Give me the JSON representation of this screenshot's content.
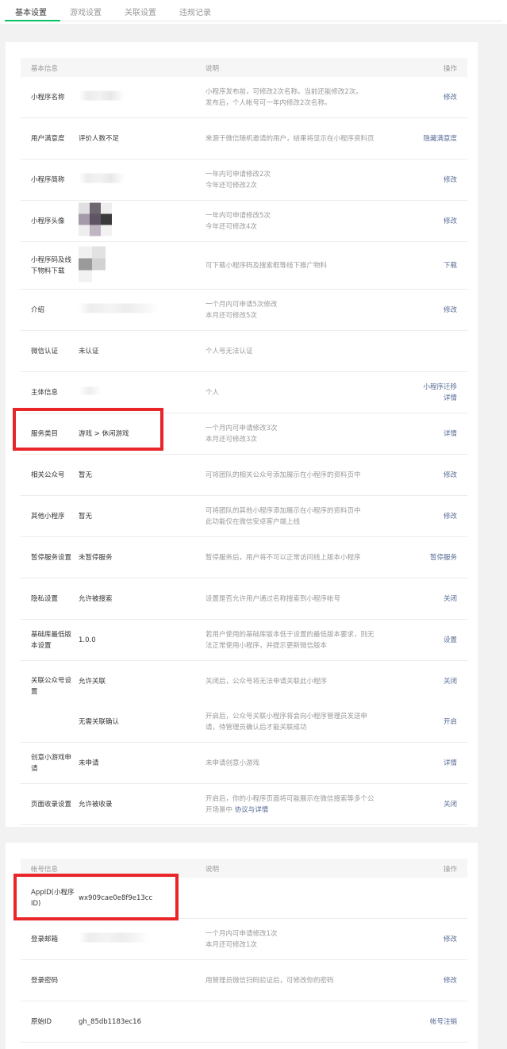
{
  "tabs": [
    "基本设置",
    "游戏设置",
    "关联设置",
    "违规记录"
  ],
  "basic": {
    "header": {
      "col1": "基本信息",
      "col2": "说明",
      "col3": "操作"
    },
    "rows": [
      {
        "label": "小程序名称",
        "value": "",
        "desc1": "小程序发布前，可修改2次名称。当前还能修改2次。",
        "desc2": "发布后，个人帐号可一年内修改2次名称。",
        "op": "修改"
      },
      {
        "label": "用户满意度",
        "value": "评价人数不足",
        "desc1": "来源于微信随机邀请的用户，结果将显示在小程序资料页",
        "desc2": "",
        "op": "隐藏满意度"
      },
      {
        "label": "小程序简称",
        "value": "",
        "desc1": "一年内可申请修改2次",
        "desc2": "今年还可修改2次",
        "op": "修改"
      },
      {
        "label": "小程序头像",
        "value": "",
        "desc1": "一年内可申请修改5次",
        "desc2": "今年还可修改4次",
        "op": "修改"
      },
      {
        "label": "小程序码及线下物料下载",
        "value": "",
        "desc1": "可下载小程序码及搜索框等线下推广物料",
        "desc2": "",
        "op": "下载"
      },
      {
        "label": "介绍",
        "value": "",
        "desc1": "一个月内可申请5次修改",
        "desc2": "本月还可修改5次",
        "op": "修改"
      },
      {
        "label": "微信认证",
        "value": "未认证",
        "desc1": "个人号无法认证",
        "desc2": "",
        "op": ""
      },
      {
        "label": "主体信息",
        "value": "",
        "desc1": "个人",
        "desc2": "",
        "op": "小程序迁移",
        "op2": "详情"
      },
      {
        "label": "服务类目",
        "value": "游戏 > 休闲游戏",
        "desc1": "一个月内可申请修改3次",
        "desc2": "本月还可修改3次",
        "op": "详情"
      },
      {
        "label": "相关公众号",
        "value": "暂无",
        "desc1": "可将团队的相关公众号添加展示在小程序的资料页中",
        "desc2": "",
        "op": "修改"
      },
      {
        "label": "其他小程序",
        "value": "暂无",
        "desc1": "可将团队的其他小程序添加展示在小程序的资料页中",
        "desc2": "此功能仅在微信安卓客户端上线",
        "op": "修改"
      },
      {
        "label": "暂停服务设置",
        "value": "未暂停服务",
        "desc1": "暂停服务后，用户将不可以正常访问线上版本小程序",
        "desc2": "",
        "op": "暂停服务"
      },
      {
        "label": "隐私设置",
        "value": "允许被搜索",
        "desc1": "设置是否允许用户通过名称搜索到小程序帐号",
        "desc2": "",
        "op": "关闭"
      },
      {
        "label": "基础库最低版本设置",
        "value": "1.0.0",
        "desc1": "若用户使用的基础库版本低于设置的最低版本要求，则无",
        "desc2": "法正常使用小程序，并提示更新微信版本",
        "op": "设置"
      },
      {
        "label": "关联公众号设置",
        "value": "允许关联",
        "desc1": "关闭后，公众号将无法申请关联此小程序",
        "desc2": "",
        "op": "关闭"
      },
      {
        "label": "",
        "value": "无需关联确认",
        "desc1": "开启后，公众号关联小程序将会向小程序管理员发送申",
        "desc2": "请，待管理员确认后才能关联成功",
        "op": "开启"
      },
      {
        "label": "创意小游戏申请",
        "value": "未申请",
        "desc1": "未申请创意小游戏",
        "desc2": "",
        "op": "详情"
      },
      {
        "label": "页面收录设置",
        "value": "允许被收录",
        "desc1": "开启后，你的小程序页面将可能展示在微信搜索等多个公",
        "desc2": "开场景中",
        "desc2_link": "协议与详情",
        "op": "关闭"
      }
    ]
  },
  "account": {
    "header": {
      "col1": "帐号信息",
      "col2": "说明",
      "col3": "操作"
    },
    "rows": [
      {
        "label": "AppID(小程序ID)",
        "value": "wx909cae0e8f9e13cc",
        "desc1": "",
        "desc2": "",
        "op": ""
      },
      {
        "label": "登录邮箱",
        "value": "",
        "desc1": "一个月内可申请修改1次",
        "desc2": "本月还可修改1次",
        "op": "修改"
      },
      {
        "label": "登录密码",
        "value": "",
        "desc1": "用管理员微信扫码验证后，可修改你的密码",
        "desc2": "",
        "op": "修改"
      },
      {
        "label": "原始ID",
        "value": "gh_85db1183ec16",
        "desc1": "",
        "desc2": "",
        "op": "帐号注销"
      }
    ]
  },
  "colors": {
    "accent": "#07c160",
    "link": "#576b95",
    "highlight": "#e8262a"
  }
}
